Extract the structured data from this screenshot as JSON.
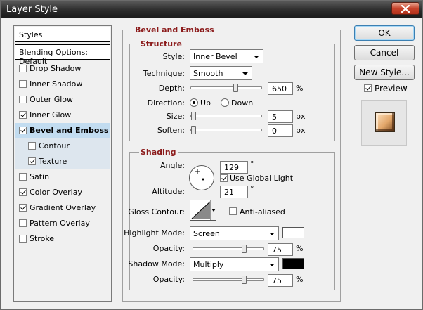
{
  "window": {
    "title": "Layer Style"
  },
  "sidebar": {
    "header": "Styles",
    "blending": "Blending Options: Default",
    "items": [
      {
        "label": "Drop Shadow",
        "checked": false,
        "sub": false,
        "selected": false
      },
      {
        "label": "Inner Shadow",
        "checked": false,
        "sub": false,
        "selected": false
      },
      {
        "label": "Outer Glow",
        "checked": false,
        "sub": false,
        "selected": false
      },
      {
        "label": "Inner Glow",
        "checked": true,
        "sub": false,
        "selected": false
      },
      {
        "label": "Bevel and Emboss",
        "checked": true,
        "sub": false,
        "selected": true
      },
      {
        "label": "Contour",
        "checked": false,
        "sub": true,
        "selected": false
      },
      {
        "label": "Texture",
        "checked": true,
        "sub": true,
        "selected": false
      },
      {
        "label": "Satin",
        "checked": false,
        "sub": false,
        "selected": false
      },
      {
        "label": "Color Overlay",
        "checked": true,
        "sub": false,
        "selected": false
      },
      {
        "label": "Gradient Overlay",
        "checked": true,
        "sub": false,
        "selected": false
      },
      {
        "label": "Pattern Overlay",
        "checked": false,
        "sub": false,
        "selected": false
      },
      {
        "label": "Stroke",
        "checked": false,
        "sub": false,
        "selected": false
      }
    ]
  },
  "panel": {
    "title": "Bevel and Emboss",
    "structure": {
      "title": "Structure",
      "style_label": "Style:",
      "style_value": "Inner Bevel",
      "technique_label": "Technique:",
      "technique_value": "Smooth",
      "depth_label": "Depth:",
      "depth_value": "650",
      "depth_unit": "%",
      "depth_level": 0.65,
      "direction_label": "Direction:",
      "direction_up": "Up",
      "direction_down": "Down",
      "direction_selected": "Up",
      "size_label": "Size:",
      "size_value": "5",
      "size_unit": "px",
      "size_level": 0.0,
      "soften_label": "Soften:",
      "soften_value": "0",
      "soften_unit": "px",
      "soften_level": 0.0
    },
    "shading": {
      "title": "Shading",
      "angle_label": "Angle:",
      "angle_value": "129",
      "angle_unit": "°",
      "global_light_label": "Use Global Light",
      "global_light_checked": true,
      "altitude_label": "Altitude:",
      "altitude_value": "21",
      "altitude_unit": "°",
      "gloss_label": "Gloss Contour:",
      "anti_aliased_label": "Anti-aliased",
      "anti_aliased_checked": false,
      "highlight_mode_label": "Highlight Mode:",
      "highlight_mode_value": "Screen",
      "highlight_color": "#ffffff",
      "highlight_opacity_label": "Opacity:",
      "highlight_opacity_value": "75",
      "highlight_opacity_unit": "%",
      "highlight_opacity_level": 0.75,
      "shadow_mode_label": "Shadow Mode:",
      "shadow_mode_value": "Multiply",
      "shadow_color": "#000000",
      "shadow_opacity_label": "Opacity:",
      "shadow_opacity_value": "75",
      "shadow_opacity_unit": "%",
      "shadow_opacity_level": 0.75
    }
  },
  "buttons": {
    "ok": "OK",
    "cancel": "Cancel",
    "new_style": "New Style...",
    "preview_label": "Preview",
    "preview_checked": true
  },
  "colors": {
    "group_title": "#8b1a1a",
    "selected_row": "#c2dcf0"
  }
}
